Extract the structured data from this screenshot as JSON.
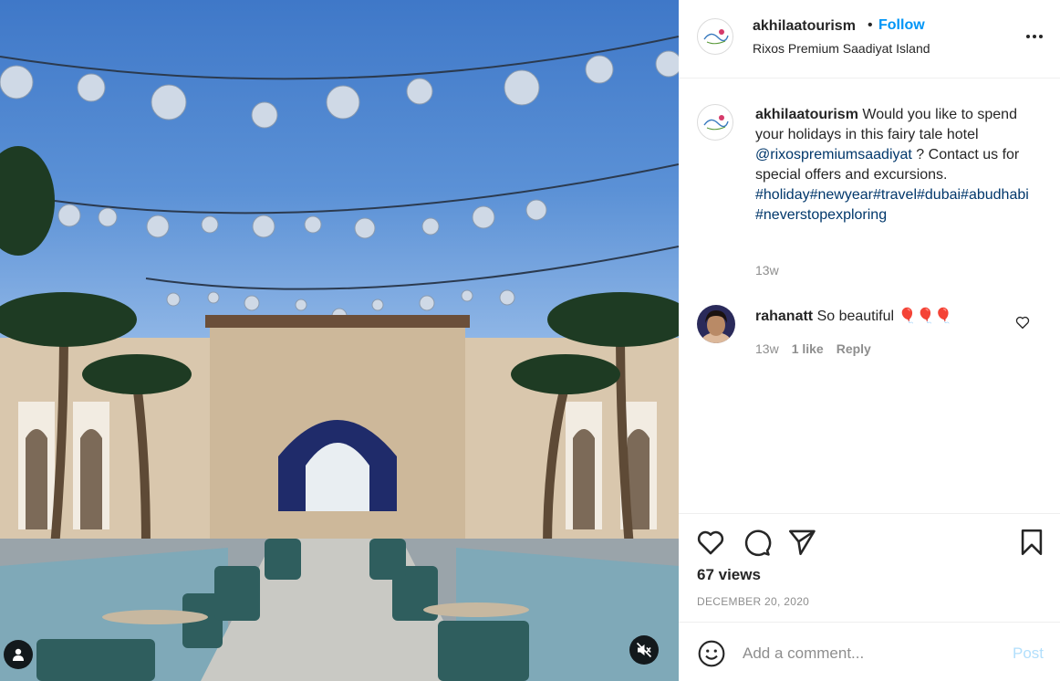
{
  "post": {
    "username": "akhilaatourism",
    "separator": "•",
    "follow_label": "Follow",
    "location": "Rixos Premium Saadiyat Island",
    "more_icon": "more-horizontal-icon",
    "caption": {
      "username": "akhilaatourism",
      "text_1": " Would you like to spend your holidays in this fairy tale hotel ",
      "mention": "@rixospremiumsaadiyat",
      "text_2": " ? Contact us for special offers and excursions. ",
      "hashtags": "#holiday#newyear#travel#dubai#abudhabi #neverstopexploring",
      "time": "13w"
    },
    "comments": [
      {
        "username": "rahanatt",
        "text": " So beautiful 🎈🎈🎈",
        "time": "13w",
        "likes": "1 like",
        "reply_label": "Reply"
      }
    ],
    "views": "67 views",
    "date": "DECEMBER 20, 2020",
    "comment_placeholder": "Add a comment...",
    "post_label": "Post"
  },
  "colors": {
    "link_blue": "#0095f6",
    "hashtag": "#00376b",
    "muted": "#8e8e8e",
    "post_disabled": "#b2dffc"
  },
  "icons": [
    "user-tag-icon",
    "muted-speaker-icon",
    "heart-icon",
    "comment-icon",
    "share-icon",
    "bookmark-icon",
    "emoji-icon"
  ]
}
